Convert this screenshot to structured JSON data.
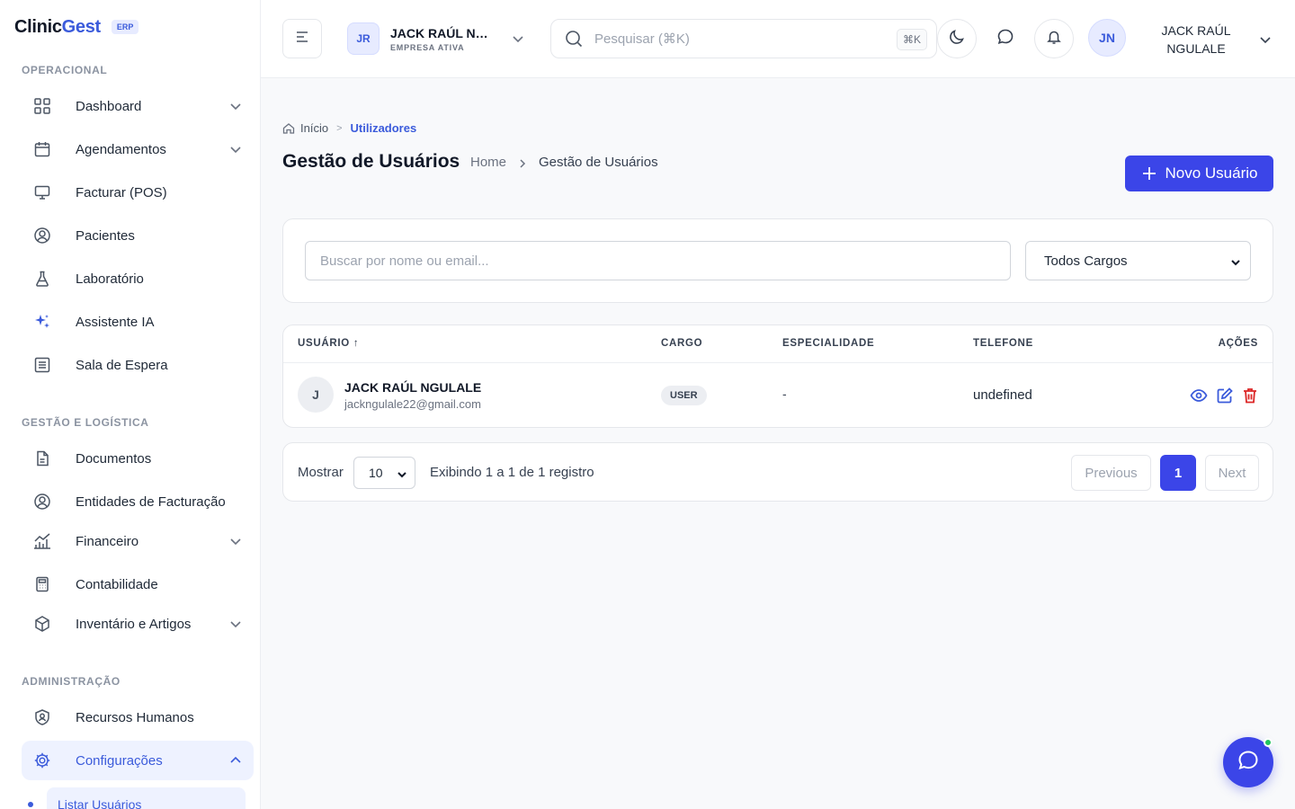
{
  "brand": {
    "name_a": "Clinic",
    "name_b": "Gest",
    "badge": "ERP"
  },
  "sidebar": {
    "sections": [
      {
        "title": "OPERACIONAL"
      },
      {
        "title": "GESTÃO E LOGÍSTICA"
      },
      {
        "title": "ADMINISTRAÇÃO"
      }
    ],
    "items": [
      {
        "label": "Dashboard",
        "icon": "grid-icon"
      },
      {
        "label": "Agendamentos",
        "icon": "calendar-icon"
      },
      {
        "label": "Facturar (POS)",
        "icon": "monitor-icon"
      },
      {
        "label": "Pacientes",
        "icon": "user-circle-icon"
      },
      {
        "label": "Laboratório",
        "icon": "flask-icon"
      },
      {
        "label": "Assistente IA",
        "icon": "sparkles-icon"
      },
      {
        "label": "Sala de Espera",
        "icon": "list-icon"
      },
      {
        "label": "Documentos",
        "icon": "document-icon"
      },
      {
        "label": "Entidades de Facturação",
        "icon": "user-circle-icon"
      },
      {
        "label": "Financeiro",
        "icon": "chart-icon"
      },
      {
        "label": "Contabilidade",
        "icon": "calculator-icon"
      },
      {
        "label": "Inventário e Artigos",
        "icon": "box-icon"
      },
      {
        "label": "Recursos Humanos",
        "icon": "shield-user-icon"
      },
      {
        "label": "Configurações",
        "icon": "gear-icon"
      }
    ],
    "sub_item": "Listar Usuários"
  },
  "header": {
    "company_initials": "JR",
    "company_name": "JACK RAÚL NGULALE",
    "company_status": "EMPRESA ATIVA",
    "search_placeholder": "Pesquisar (⌘K)",
    "search_shortcut": "⌘K",
    "user_initials": "JN",
    "user_name": "JACK RAÚL NGULALE"
  },
  "breadcrumb": {
    "home": "Início",
    "current": "Utilizadores"
  },
  "page": {
    "title": "Gestão de Usuários",
    "sub_home": "Home",
    "sub_current": "Gestão de Usuários",
    "new_button": "Novo Usuário"
  },
  "filters": {
    "search_placeholder": "Buscar por nome ou email...",
    "role_selected": "Todos Cargos"
  },
  "table": {
    "columns": [
      "USUÁRIO ↑",
      "CARGO",
      "ESPECIALIDADE",
      "TELEFONE",
      "AÇÕES"
    ],
    "rows": [
      {
        "initial": "J",
        "name": "JACK RAÚL NGULALE",
        "email": "jackngulale22@gmail.com",
        "role": "USER",
        "specialty": "-",
        "phone": "undefined"
      }
    ]
  },
  "pagination": {
    "show_label": "Mostrar",
    "page_size": "10",
    "info": "Exibindo 1 a 1 de 1 registro",
    "previous": "Previous",
    "current_page": "1",
    "next": "Next"
  },
  "colors": {
    "accent": "#3b45e8",
    "brand_blue": "#3b5bdb",
    "online": "#22c55e",
    "danger": "#dc2626"
  }
}
